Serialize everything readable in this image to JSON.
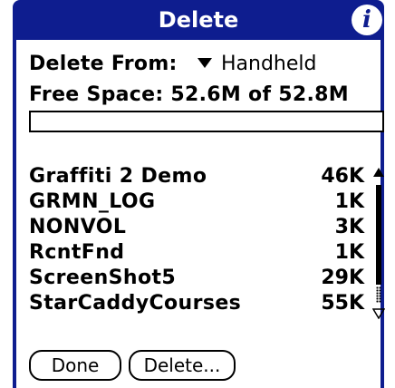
{
  "window": {
    "title": "Delete",
    "info_icon": "info-icon",
    "accent_color": "#0e1d8f"
  },
  "delete_from": {
    "label": "Delete From:",
    "selected": "Handheld"
  },
  "free_space": {
    "label": "Free Space: 52.6M of 52.8M",
    "used_fraction": 0.0
  },
  "files": [
    {
      "name": "Graffiti 2 Demo",
      "size": "46K"
    },
    {
      "name": "GRMN_LOG",
      "size": "1K"
    },
    {
      "name": "NONVOL",
      "size": "3K"
    },
    {
      "name": "RcntFnd",
      "size": "1K"
    },
    {
      "name": "ScreenShot5",
      "size": "29K"
    },
    {
      "name": "StarCaddyCourses",
      "size": "55K"
    }
  ],
  "buttons": {
    "done": "Done",
    "delete": "Delete..."
  }
}
